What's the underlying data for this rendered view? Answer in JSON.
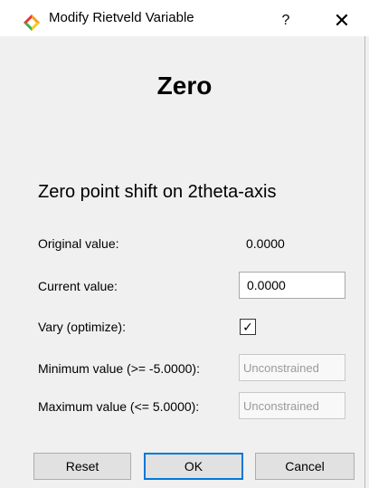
{
  "window": {
    "title": "Modify Rietveld Variable",
    "help_glyph": "?",
    "close_glyph": "✕",
    "icon": "diamond-app-icon"
  },
  "heading": "Zero",
  "description": "Zero point shift on 2theta-axis",
  "fields": {
    "original_label": "Original value:",
    "original_value": "0.0000",
    "current_label": "Current value:",
    "current_value": "0.0000",
    "vary_label": "Vary (optimize):",
    "vary_checked": true,
    "vary_glyph": "✓",
    "min_label": "Minimum value (>= -5.0000):",
    "min_placeholder": "Unconstrained",
    "max_label": "Maximum value (<=  5.0000):",
    "max_placeholder": "Unconstrained"
  },
  "buttons": {
    "reset": "Reset",
    "ok": "OK",
    "cancel": "Cancel"
  },
  "colors": {
    "accent": "#0078d7",
    "window_bg": "#f0f0f0"
  }
}
